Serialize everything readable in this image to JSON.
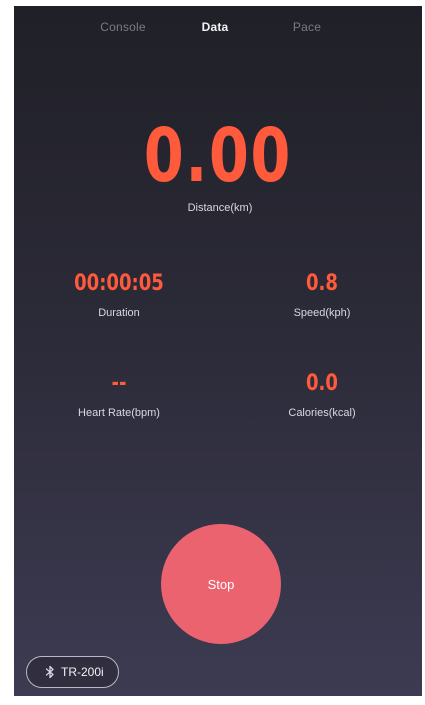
{
  "tabs": [
    {
      "label": "Console",
      "active": false
    },
    {
      "label": "Data",
      "active": true
    },
    {
      "label": "Pace",
      "active": false
    }
  ],
  "distance": {
    "value": "0.00",
    "label": "Distance(km)"
  },
  "metrics": {
    "duration": {
      "value": "00:00:05",
      "label": "Duration"
    },
    "speed": {
      "value": "0.8",
      "label": "Speed(kph)"
    },
    "heart_rate": {
      "value": "--",
      "label": "Heart Rate(bpm)"
    },
    "calories": {
      "value": "0.0",
      "label": "Calories(kcal)"
    }
  },
  "stop_button": {
    "label": "Stop"
  },
  "device": {
    "name": "TR-200i",
    "icon": "bluetooth-icon"
  },
  "colors": {
    "accent": "#ff5a3c",
    "stop": "#ec6370",
    "background_top": "#202028",
    "background_bottom": "#3d3b52"
  }
}
